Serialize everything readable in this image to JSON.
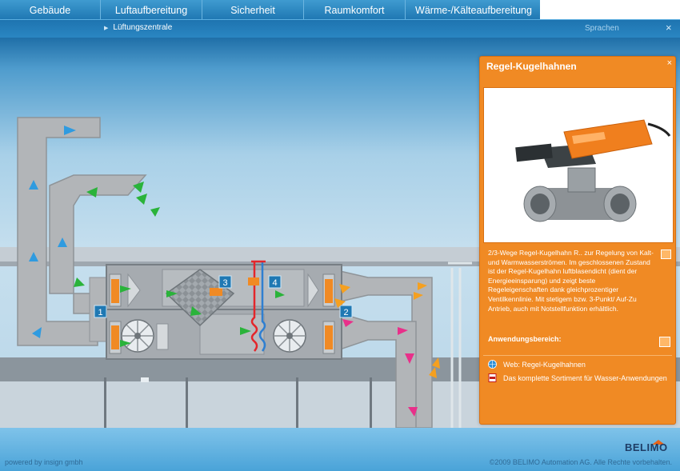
{
  "nav": {
    "tabs": [
      {
        "label": "Gebäude"
      },
      {
        "label": "Luftaufbereitung"
      },
      {
        "label": "Sicherheit"
      },
      {
        "label": "Raumkomfort"
      },
      {
        "label": "Wärme-/Kälteaufbereitung"
      }
    ]
  },
  "subnav": {
    "title": "Lüftungszentrale",
    "language": "Sprachen",
    "close": "×"
  },
  "scene": {
    "markers": [
      "1",
      "2",
      "3",
      "4"
    ]
  },
  "panel": {
    "title": "Regel-Kugelhahnen",
    "close": "×",
    "description": "2/3-Wege Regel-Kugelhahn R.. zur Regelung von Kalt- und Warmwasserströmen. Im geschlossenen Zustand ist der Regel-Kugelhahn luftblasendicht (dient der Energieeinsparung) und zeigt beste Regeleigenschaften dank gleichprozentiger Ventilkennlinie. Mit stetigem bzw. 3-Punkt/ Auf-Zu Antrieb, auch mit Notstellfunktion erhältlich.",
    "usage_label": "Anwendungsbereich:",
    "links": [
      {
        "label": "Web: Regel-Kugelhahnen",
        "icon": "globe-icon"
      },
      {
        "label": "Das komplette Sortiment für Wasser-Anwendungen",
        "icon": "pdf-icon"
      }
    ]
  },
  "footer": {
    "powered": "powered by insign gmbh",
    "copyright": "©2009 BELIMO Automation AG. Alle Rechte vorbehalten.",
    "brand": "BELIMO"
  },
  "colors": {
    "accent_orange": "#f08a24",
    "nav_blue": "#1f78b3",
    "duct_gray": "#b2b5b8",
    "air_blue": "#2f9be0",
    "air_green": "#2ab33a",
    "air_orange": "#f5a020",
    "air_pink": "#e8308a"
  }
}
